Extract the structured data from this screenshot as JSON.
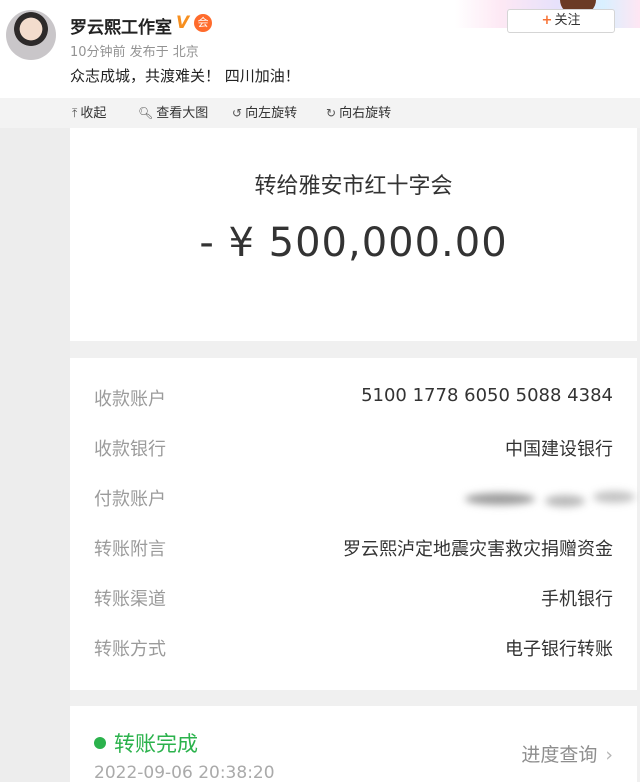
{
  "post": {
    "author": "罗云熙工作室",
    "meta": "10分钟前  发布于 北京",
    "text": "众志成城，共渡难关！ 四川加油！",
    "follow_label": "关注",
    "verified_badge": "V",
    "vip_badge": "会"
  },
  "toolbar": {
    "items": [
      {
        "label": "收起"
      },
      {
        "label": "查看大图"
      },
      {
        "label": "向左旋转"
      },
      {
        "label": "向右旋转"
      }
    ]
  },
  "receipt": {
    "recipient": "转给雅安市红十字会",
    "amount": "- ¥ 500,000.00",
    "details": [
      {
        "label": "收款账户",
        "value": "5100 1778 6050 5088 4384"
      },
      {
        "label": "收款银行",
        "value": "中国建设银行"
      },
      {
        "label": "付款账户",
        "value": ""
      },
      {
        "label": "转账附言",
        "value": "罗云熙泸定地震灾害救灾捐赠资金"
      },
      {
        "label": "转账渠道",
        "value": "手机银行"
      },
      {
        "label": "转账方式",
        "value": "电子银行转账"
      }
    ],
    "status": "转账完成",
    "timestamp": "2022-09-06 20:38:20",
    "progress_label": "进度查询"
  },
  "colors": {
    "status_green": "#2bb24c",
    "follow_plus": "#f77234",
    "verified_orange": "#f78f1f"
  }
}
